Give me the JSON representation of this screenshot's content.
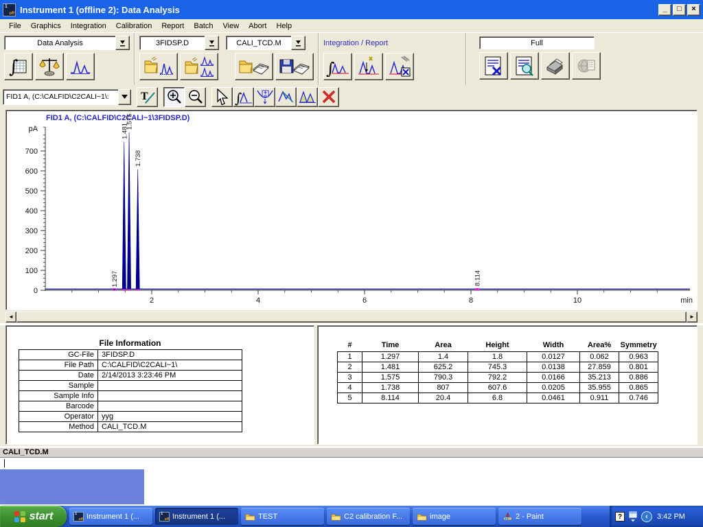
{
  "window": {
    "title": "Instrument 1 (offline 2): Data Analysis",
    "minimize": "_",
    "maximize": "□",
    "close": "×"
  },
  "menu": {
    "items": [
      "File",
      "Graphics",
      "Integration",
      "Calibration",
      "Report",
      "Batch",
      "View",
      "Abort",
      "Help"
    ]
  },
  "toolbar": {
    "view_combo": "Data Analysis",
    "data_combo": "3FIDSP.D",
    "method_combo": "CALI_TCD.M",
    "section_label": "Integration / Report",
    "report_style": "Full",
    "signal_combo": "FID1 A, (C:\\CALFID\\C2CALI~1\\:"
  },
  "chart_data": {
    "type": "line",
    "title": "FID1 A, (C:\\CALFID\\C2CALI~1\\3FIDSP.D)",
    "ylabel": "pA",
    "xlabel": "min",
    "xlim": [
      0,
      12.1
    ],
    "ylim": [
      0,
      830
    ],
    "x_major_ticks": [
      2,
      4,
      6,
      8,
      10
    ],
    "x_minor_step": 0.5,
    "y_major_ticks": [
      0,
      100,
      200,
      300,
      400,
      500,
      600,
      700
    ],
    "y_minor_step": 20,
    "grid": false,
    "baseline_pa": 6,
    "line_color": "#00008c",
    "marker_color": "#ff22dd",
    "title_color": "#2323cb",
    "peaks": [
      {
        "time": 1.297,
        "height": 1.8,
        "label": "1.297"
      },
      {
        "time": 1.481,
        "height": 745.3,
        "label": "1.481"
      },
      {
        "time": 1.575,
        "height": 792.2,
        "label": "1.575"
      },
      {
        "time": 1.738,
        "height": 607.6,
        "label": "1.738"
      },
      {
        "time": 8.114,
        "height": 6.8,
        "label": "8.114"
      }
    ]
  },
  "file_info": {
    "title": "File Information",
    "rows": [
      [
        "GC-File",
        "3FIDSP.D"
      ],
      [
        "File Path",
        "C:\\CALFID\\C2CALI~1\\"
      ],
      [
        "Date",
        "2/14/2013 3:23:46 PM"
      ],
      [
        "Sample",
        ""
      ],
      [
        "Sample Info",
        ""
      ],
      [
        "Barcode",
        ""
      ],
      [
        "Operator",
        "yyg"
      ],
      [
        "Method",
        "CALI_TCD.M"
      ]
    ]
  },
  "peak_table": {
    "headers": [
      "#",
      "Time",
      "Area",
      "Height",
      "Width",
      "Area%",
      "Symmetry"
    ],
    "rows": [
      [
        "1",
        "1.297",
        "1.4",
        "1.8",
        "0.0127",
        "0.062",
        "0.963"
      ],
      [
        "2",
        "1.481",
        "625.2",
        "745.3",
        "0.0138",
        "27.859",
        "0.801"
      ],
      [
        "3",
        "1.575",
        "790.3",
        "792.2",
        "0.0166",
        "35.213",
        "0.886"
      ],
      [
        "4",
        "1.738",
        "807",
        "607.6",
        "0.0205",
        "35.955",
        "0.865"
      ],
      [
        "5",
        "8.114",
        "20.4",
        "6.8",
        "0.0461",
        "0.911",
        "0.746"
      ]
    ]
  },
  "status_bar": {
    "method": "CALI_TCD.M"
  },
  "taskbar": {
    "start_label": "start",
    "items": [
      {
        "label": "Instrument 1 (..."
      },
      {
        "label": "Instrument 1 (..."
      },
      {
        "label": "TEST"
      },
      {
        "label": "C2 calibration F..."
      },
      {
        "label": "image"
      },
      {
        "label": "2 - Paint"
      }
    ],
    "time": "3:42 PM"
  }
}
